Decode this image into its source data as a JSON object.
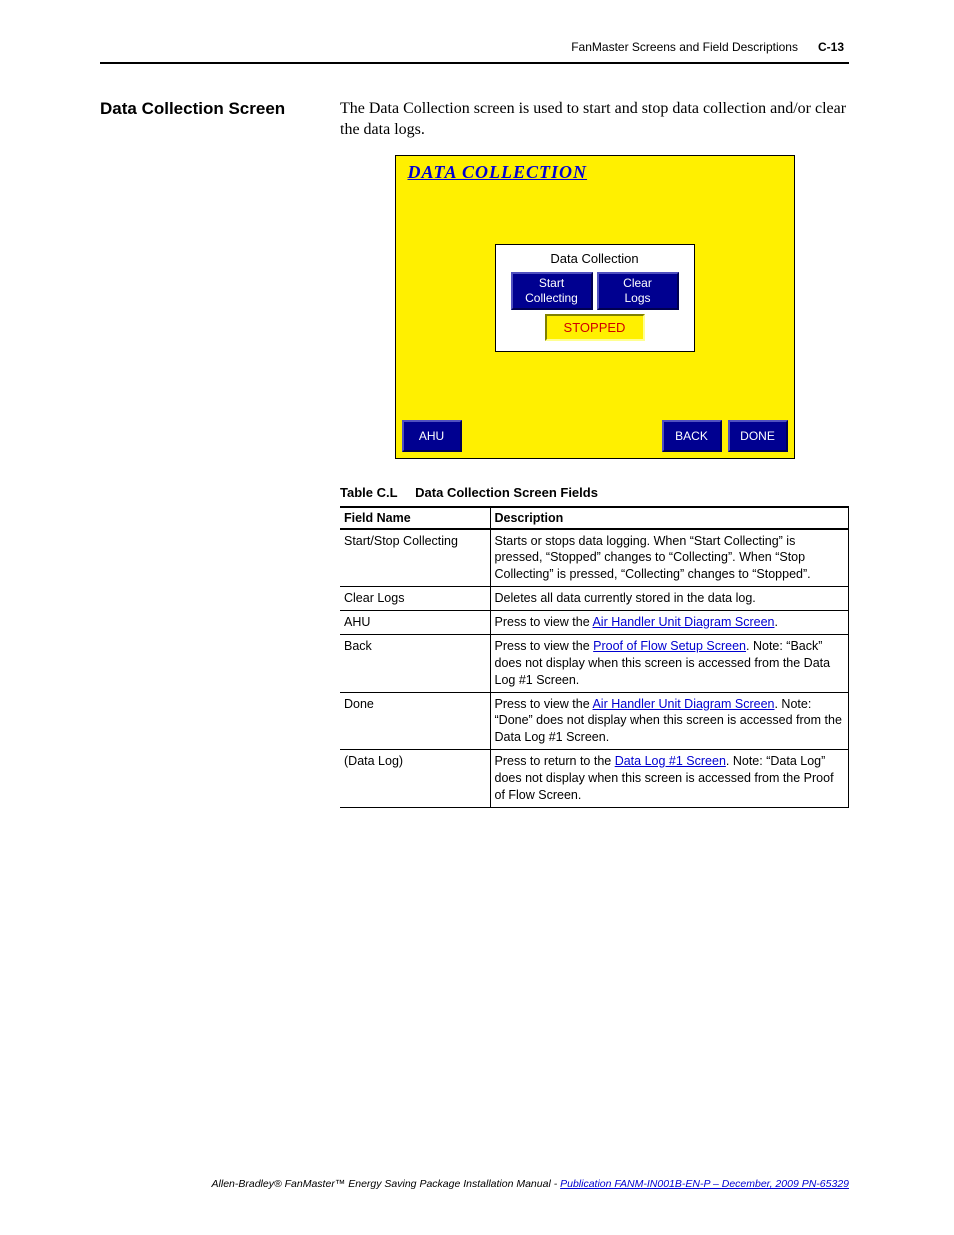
{
  "header": {
    "title": "FanMaster Screens and Field Descriptions",
    "page": "C-13"
  },
  "section": {
    "title": "Data Collection Screen",
    "intro": "The Data Collection screen is used to start and stop data collection and/or clear the data logs."
  },
  "screenshot": {
    "title": "DATA COLLECTION",
    "panel_title": "Data Collection",
    "btn_start_line1": "Start",
    "btn_start_line2": "Collecting",
    "btn_clear_line1": "Clear",
    "btn_clear_line2": "Logs",
    "status": "STOPPED",
    "nav_ahu": "AHU",
    "nav_back": "BACK",
    "nav_done": "DONE"
  },
  "table": {
    "caption_label": "Table C.L",
    "caption_text": "Data Collection Screen Fields",
    "head_field": "Field Name",
    "head_desc": "Description",
    "rows": {
      "r0": {
        "field": "Start/Stop Collecting",
        "desc": "Starts or stops data logging. When “Start Collecting” is pressed, “Stopped” changes to “Collecting”. When “Stop Collecting” is pressed, “Collecting” changes to “Stopped”."
      },
      "r1": {
        "field": "Clear Logs",
        "desc": "Deletes all data currently stored in the data log."
      },
      "r2": {
        "field": "AHU",
        "desc_pre": "Press to view the ",
        "link": "Air Handler Unit Diagram Screen",
        "desc_post": "."
      },
      "r3": {
        "field": "Back",
        "desc_pre": "Press to view the ",
        "link": "Proof of Flow Setup Screen",
        "desc_post": ". Note: “Back” does not display when this screen is accessed from the Data Log #1 Screen."
      },
      "r4": {
        "field": "Done",
        "desc_pre": "Press to view the ",
        "link": "Air Handler Unit Diagram Screen",
        "desc_post": ". Note: “Done” does not display when this screen is accessed from the Data Log #1 Screen."
      },
      "r5": {
        "field": "(Data Log)",
        "desc_pre": "Press to return to the ",
        "link": "Data Log #1 Screen",
        "desc_post": ". Note: “Data Log” does not display when this screen is accessed from the Proof of Flow Screen."
      }
    }
  },
  "footer": {
    "pre": "Allen-Bradley® FanMaster™ Energy Saving Package Installation Manual - ",
    "link": "Publication FANM-IN001B-EN-P – December, 2009 PN-65329"
  }
}
